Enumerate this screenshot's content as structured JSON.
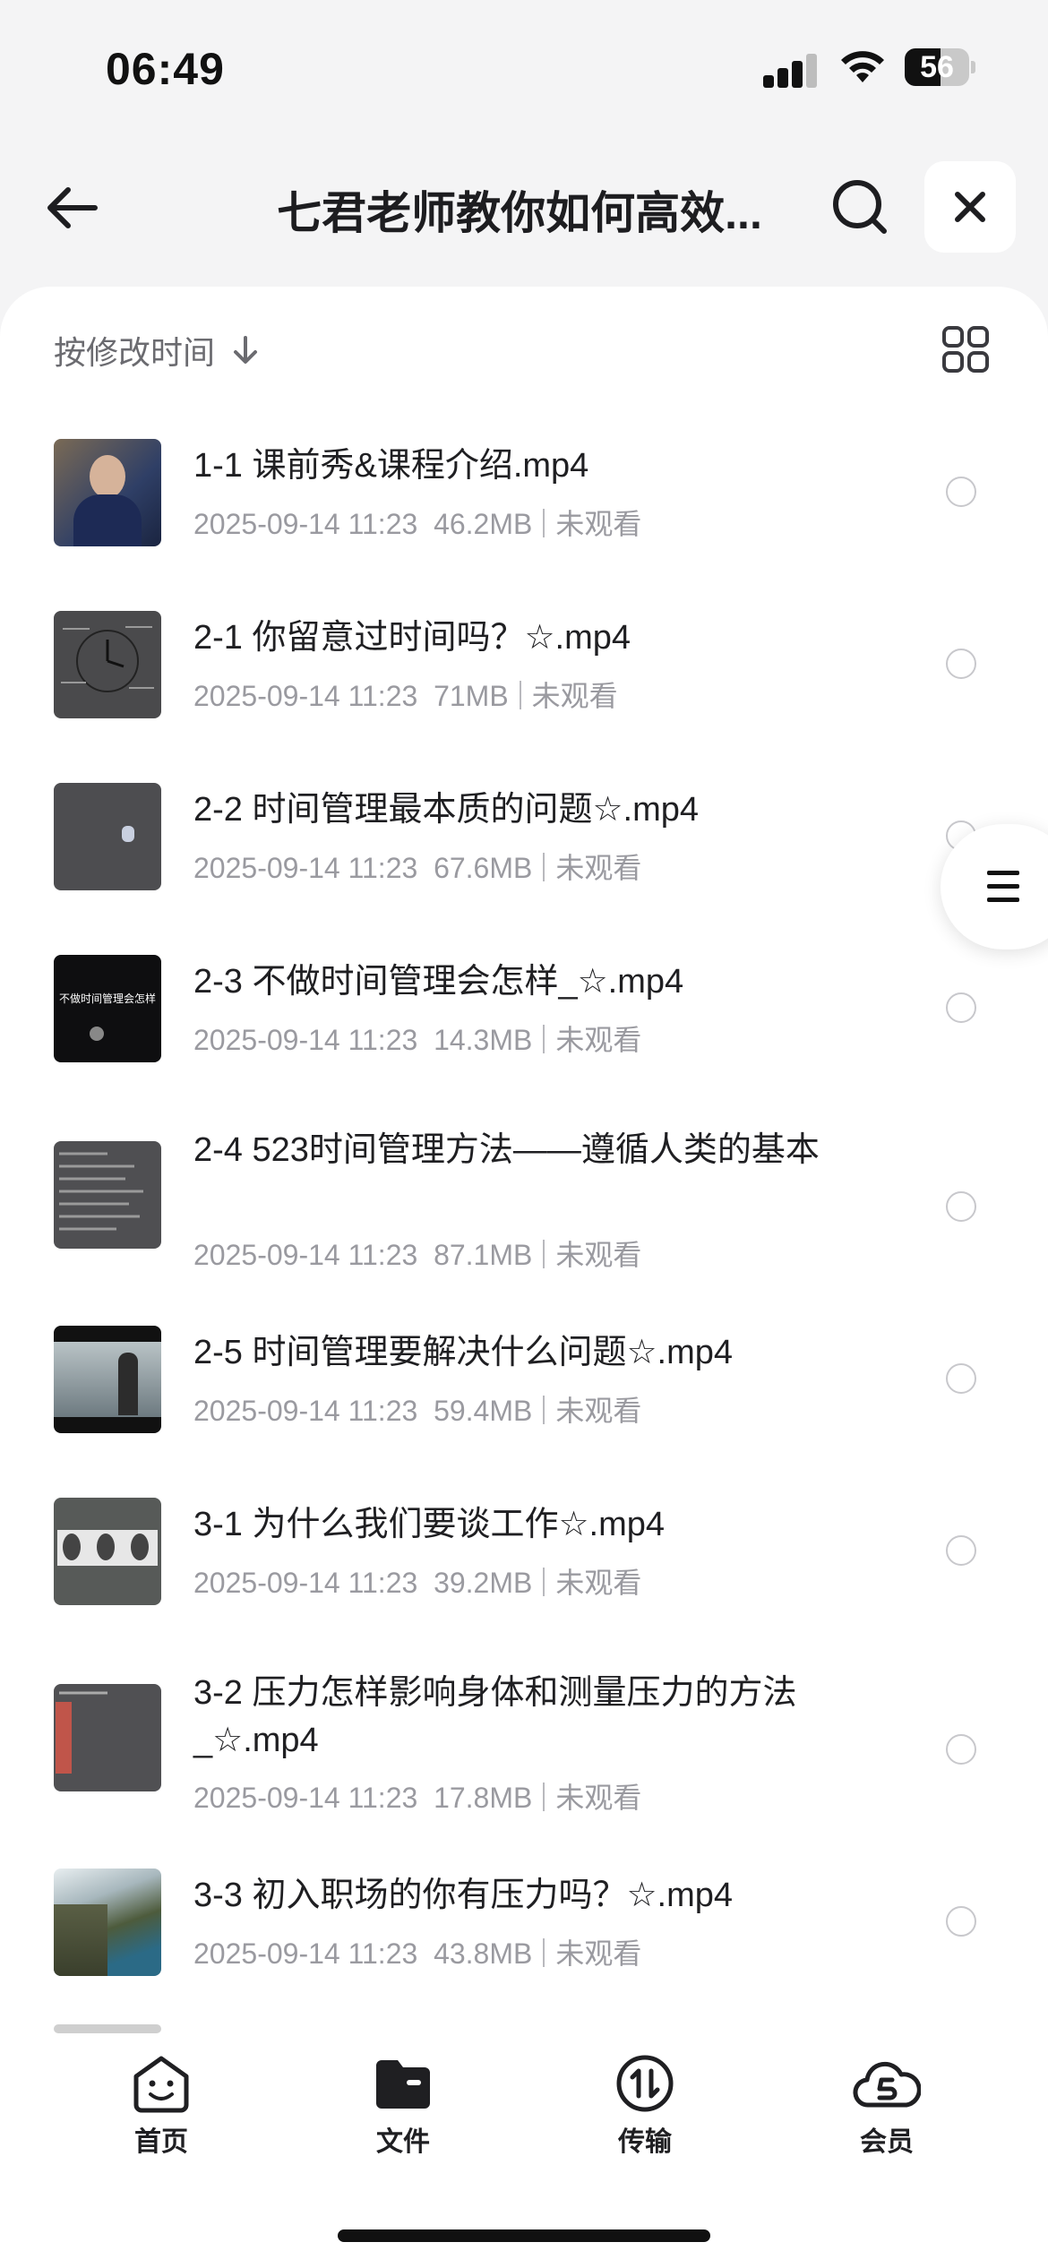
{
  "status_bar": {
    "time": "06:49",
    "battery": "56"
  },
  "header": {
    "title": "七君老师教你如何高效..."
  },
  "sort": {
    "label": "按修改时间"
  },
  "files": [
    {
      "name": "1-1 课前秀&课程介绍.mp4",
      "date": "2025-09-14 11:23",
      "size": "46.2MB",
      "status": "未观看"
    },
    {
      "name": "2-1 你留意过时间吗？☆.mp4",
      "date": "2025-09-14 11:23",
      "size": "71MB",
      "status": "未观看"
    },
    {
      "name": "2-2 时间管理最本质的问题☆.mp4",
      "date": "2025-09-14 11:23",
      "size": "67.6MB",
      "status": "未观看"
    },
    {
      "name": "2-3 不做时间管理会怎样_☆.mp4",
      "date": "2025-09-14 11:23",
      "size": "14.3MB",
      "status": "未观看"
    },
    {
      "name": "2-4 523时间管理方法——遵循人类的基本",
      "date": "2025-09-14 11:23",
      "size": "87.1MB",
      "status": "未观看"
    },
    {
      "name": "2-5 时间管理要解决什么问题☆.mp4",
      "date": "2025-09-14 11:23",
      "size": "59.4MB",
      "status": "未观看"
    },
    {
      "name": "3-1 为什么我们要谈工作☆.mp4",
      "date": "2025-09-14 11:23",
      "size": "39.2MB",
      "status": "未观看"
    },
    {
      "name": "3-2 压力怎样影响身体和测量压力的方法_☆.mp4",
      "date": "2025-09-14 11:23",
      "size": "17.8MB",
      "status": "未观看"
    },
    {
      "name": "3-3 初入职场的你有压力吗？☆.mp4",
      "date": "2025-09-14 11:23",
      "size": "43.8MB",
      "status": "未观看"
    }
  ],
  "thumb_text": {
    "t4": "不做时间管理会怎样"
  },
  "tabs": [
    {
      "label": "首页",
      "icon": "home-smile-icon"
    },
    {
      "label": "文件",
      "icon": "folder-icon"
    },
    {
      "label": "传输",
      "icon": "transfer-icon"
    },
    {
      "label": "会员",
      "icon": "vip-cloud-icon"
    }
  ]
}
